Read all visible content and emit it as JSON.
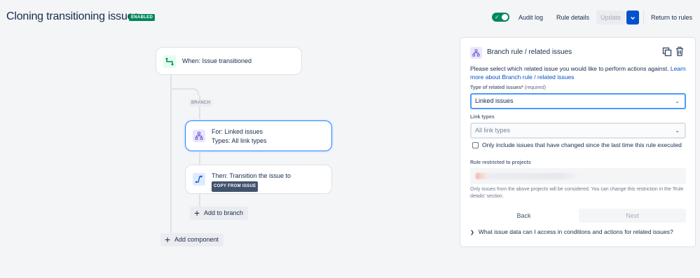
{
  "header": {
    "title": "Cloning transitioning issues",
    "status_badge": "ENABLED",
    "audit_log": "Audit log",
    "rule_details": "Rule details",
    "update": "Update",
    "return_to_rules": "Return to rules"
  },
  "flow": {
    "trigger": "When: Issue transitioned",
    "branch_label": "BRANCH",
    "branch_card": {
      "line1": "For: Linked issues",
      "line2": "Types: All link types"
    },
    "action_card": {
      "line1": "Then: Transition the issue to",
      "tag": "COPY FROM ISSUE"
    },
    "add_to_branch": "Add to branch",
    "add_component": "Add component"
  },
  "panel": {
    "title": "Branch rule / related issues",
    "description": "Please select which related issue you would like to perform actions against. ",
    "learn_more": "Learn more about Branch rule / related issues",
    "type_label": "Type of related issues",
    "required_mark": "*",
    "required_text": "(required)",
    "type_value": "Linked issues",
    "link_types_label": "Link types",
    "link_types_placeholder": "All link types",
    "checkbox_label": "Only include issues that have changed since the last time this rule executed",
    "projects_label": "Rule restricted to projects",
    "projects_note": "Only issues from the above projects will be considered. You can change this restriction in the 'Rule details' section.",
    "back": "Back",
    "next": "Next",
    "faq": "What issue data can I access in conditions and actions for related issues?"
  },
  "colors": {
    "accent": "#0052cc",
    "enabled": "#00875a",
    "selected_border": "#2684ff"
  },
  "icons": {
    "toggle": "check-icon",
    "trigger": "transition-icon",
    "branch": "branch-tree-icon",
    "action": "transition-arrow-icon",
    "copy": "copy-icon",
    "delete": "trash-icon"
  }
}
